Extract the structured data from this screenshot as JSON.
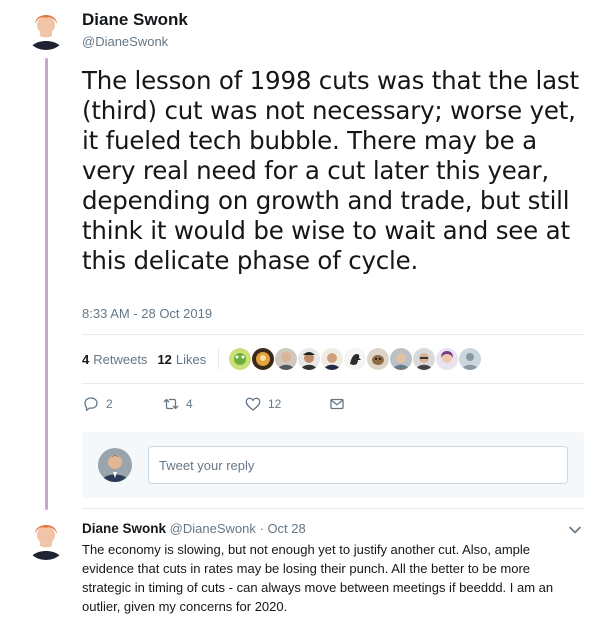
{
  "tweet": {
    "author": {
      "display_name": "Diane Swonk",
      "handle": "@DianeSwonk"
    },
    "text": "The lesson of 1998 cuts was that the last (third) cut was not necessary; worse yet, it fueled tech bubble. There may be a very real need for a cut later this year, depending on growth and trade, but still think it would be wise to wait and see at this delicate phase of cycle.",
    "timestamp": "8:33 AM - 28 Oct 2019",
    "stats": {
      "retweets_count": "4",
      "retweets_label": "Retweets",
      "likes_count": "12",
      "likes_label": "Likes"
    },
    "actions": {
      "reply_count": "2",
      "retweet_count": "4",
      "like_count": "12"
    }
  },
  "reply_box": {
    "placeholder": "Tweet your reply"
  },
  "reply": {
    "display_name": "Diane Swonk",
    "handle": "@DianeSwonk",
    "separator": "·",
    "date": "Oct 28",
    "text": "The economy is slowing, but not enough yet to justify another cut. Also, ample evidence that cuts in rates may be losing their punch. All the better to be more strategic in timing of cuts - can always move between meetings if beeddd. I am an outlier, given my concerns for 2020."
  },
  "colors": {
    "thread_line": "#c8a6cf",
    "secondary_text": "#657786",
    "primary_text": "#14171a",
    "reply_box_bg": "#f5f8fa"
  },
  "icons": {
    "reply": "reply-icon",
    "retweet": "retweet-icon",
    "like": "heart-icon",
    "dm": "envelope-icon",
    "more": "chevron-down-icon"
  }
}
